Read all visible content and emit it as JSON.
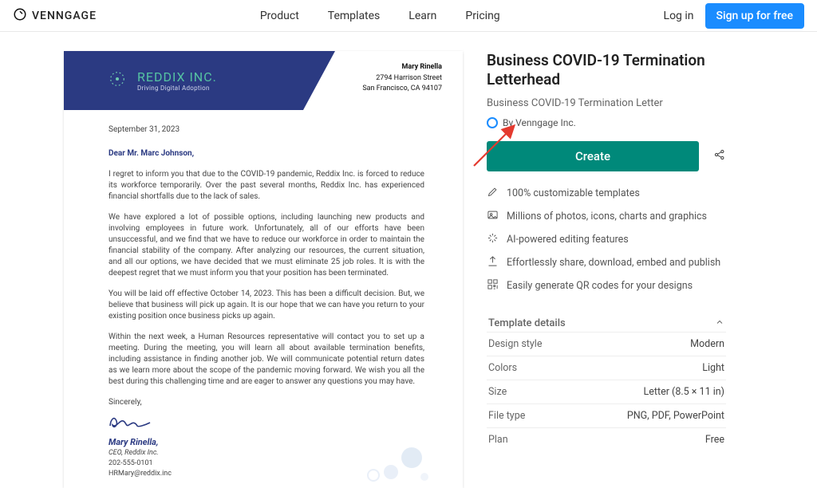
{
  "brand": "VENNGAGE",
  "nav": {
    "product": "Product",
    "templates": "Templates",
    "learn": "Learn",
    "pricing": "Pricing",
    "login": "Log in",
    "signup": "Sign up for free"
  },
  "panel": {
    "title": "Business COVID-19 Termination Letterhead",
    "subtitle": "Business COVID-19 Termination Letter",
    "by": "By Venngage Inc.",
    "create": "Create",
    "features": [
      "100% customizable templates",
      "Millions of photos, icons, charts and graphics",
      "AI-powered editing features",
      "Effortlessly share, download, embed and publish",
      "Easily generate QR codes for your designs"
    ],
    "details_label": "Template details",
    "details": [
      {
        "k": "Design style",
        "v": "Modern"
      },
      {
        "k": "Colors",
        "v": "Light"
      },
      {
        "k": "Size",
        "v": "Letter (8.5 × 11 in)"
      },
      {
        "k": "File type",
        "v": "PNG, PDF, PowerPoint"
      },
      {
        "k": "Plan",
        "v": "Free"
      }
    ]
  },
  "letter": {
    "company": "REDDIX INC.",
    "tagline": "Driving Digital Adoption",
    "sender_name": "Mary Rinella",
    "sender_addr1": "2794 Harrison Street",
    "sender_addr2": "San Francisco, CA 94107",
    "date": "September 31, 2023",
    "greet": "Dear Mr. Marc Johnson,",
    "p1": "I regret to inform you that due to the COVID-19 pandemic, Reddix Inc. is forced to reduce its workforce temporarily. Over the past several months, Reddix Inc. has experienced financial shortfalls due to the lack of sales.",
    "p2": "We have explored a lot of possible options, including launching new products and involving employees in future work. Unfortunately, all of our efforts have been unsuccessful, and we find that we have to reduce our workforce in order to maintain the financial stability of the company. After analyzing our resources, the current situation, and all our options, we have decided that we must eliminate 25 job roles. It is with the deepest regret that we must inform you that your position has been terminated.",
    "p3": "You will be laid off effective October 14, 2023. This has been a difficult decision. But, we believe that business will pick up again. It is our hope that we can have you return to your existing position once business picks up again.",
    "p4": "Within the next week, a Human Resources representative will contact you to set up a meeting. During the meeting, you will learn all about available termination benefits, including assistance in finding another job. We will communicate potential return dates as we learn more about the scope of the pandemic moving forward. We wish you all the best during this challenging time and are eager to answer any questions you may have.",
    "closer": "Sincerely,",
    "sig_name": "Mary Rinella,",
    "sig_role": "CEO, Reddix Inc.",
    "sig_phone": "202-555-0101",
    "sig_email": "HRMary@reddix.inc"
  }
}
